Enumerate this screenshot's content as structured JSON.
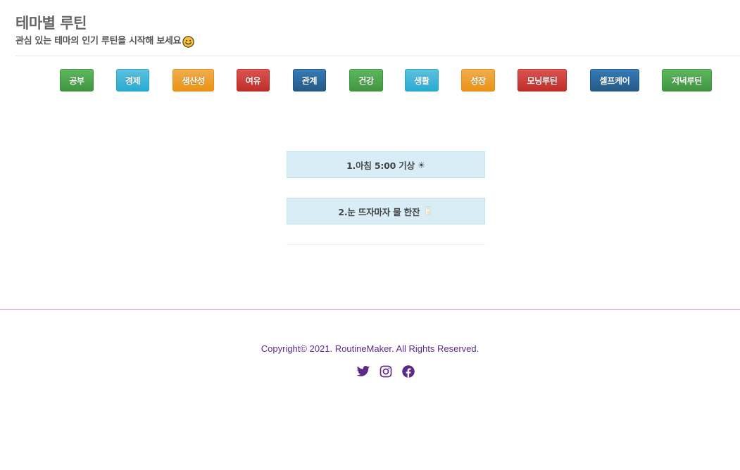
{
  "header": {
    "title": "테마별 루틴",
    "subtitle": "관심 있는 테마의 인기 루틴을 시작해 보세요"
  },
  "themes": [
    {
      "label": "공부",
      "color": "green"
    },
    {
      "label": "경제",
      "color": "teal"
    },
    {
      "label": "생산성",
      "color": "orange"
    },
    {
      "label": "여유",
      "color": "red"
    },
    {
      "label": "관계",
      "color": "navy"
    },
    {
      "label": "건강",
      "color": "green"
    },
    {
      "label": "생활",
      "color": "teal"
    },
    {
      "label": "성장",
      "color": "orange"
    },
    {
      "label": "모닝루틴",
      "color": "red"
    },
    {
      "label": "셀프케어",
      "color": "navy"
    },
    {
      "label": "저녁루틴",
      "color": "green"
    }
  ],
  "routines": [
    {
      "text": "1.아침 5:00 기상",
      "emoji": "☀"
    },
    {
      "text": "2.눈 뜨자마자 물 한잔",
      "emoji": "🥛"
    }
  ],
  "footer": {
    "copyright": "Copyright© 2021. RoutineMaker. All Rights Reserved.",
    "social": [
      "twitter-icon",
      "instagram-icon",
      "facebook-icon"
    ],
    "accent_color": "#5e2a8a"
  }
}
